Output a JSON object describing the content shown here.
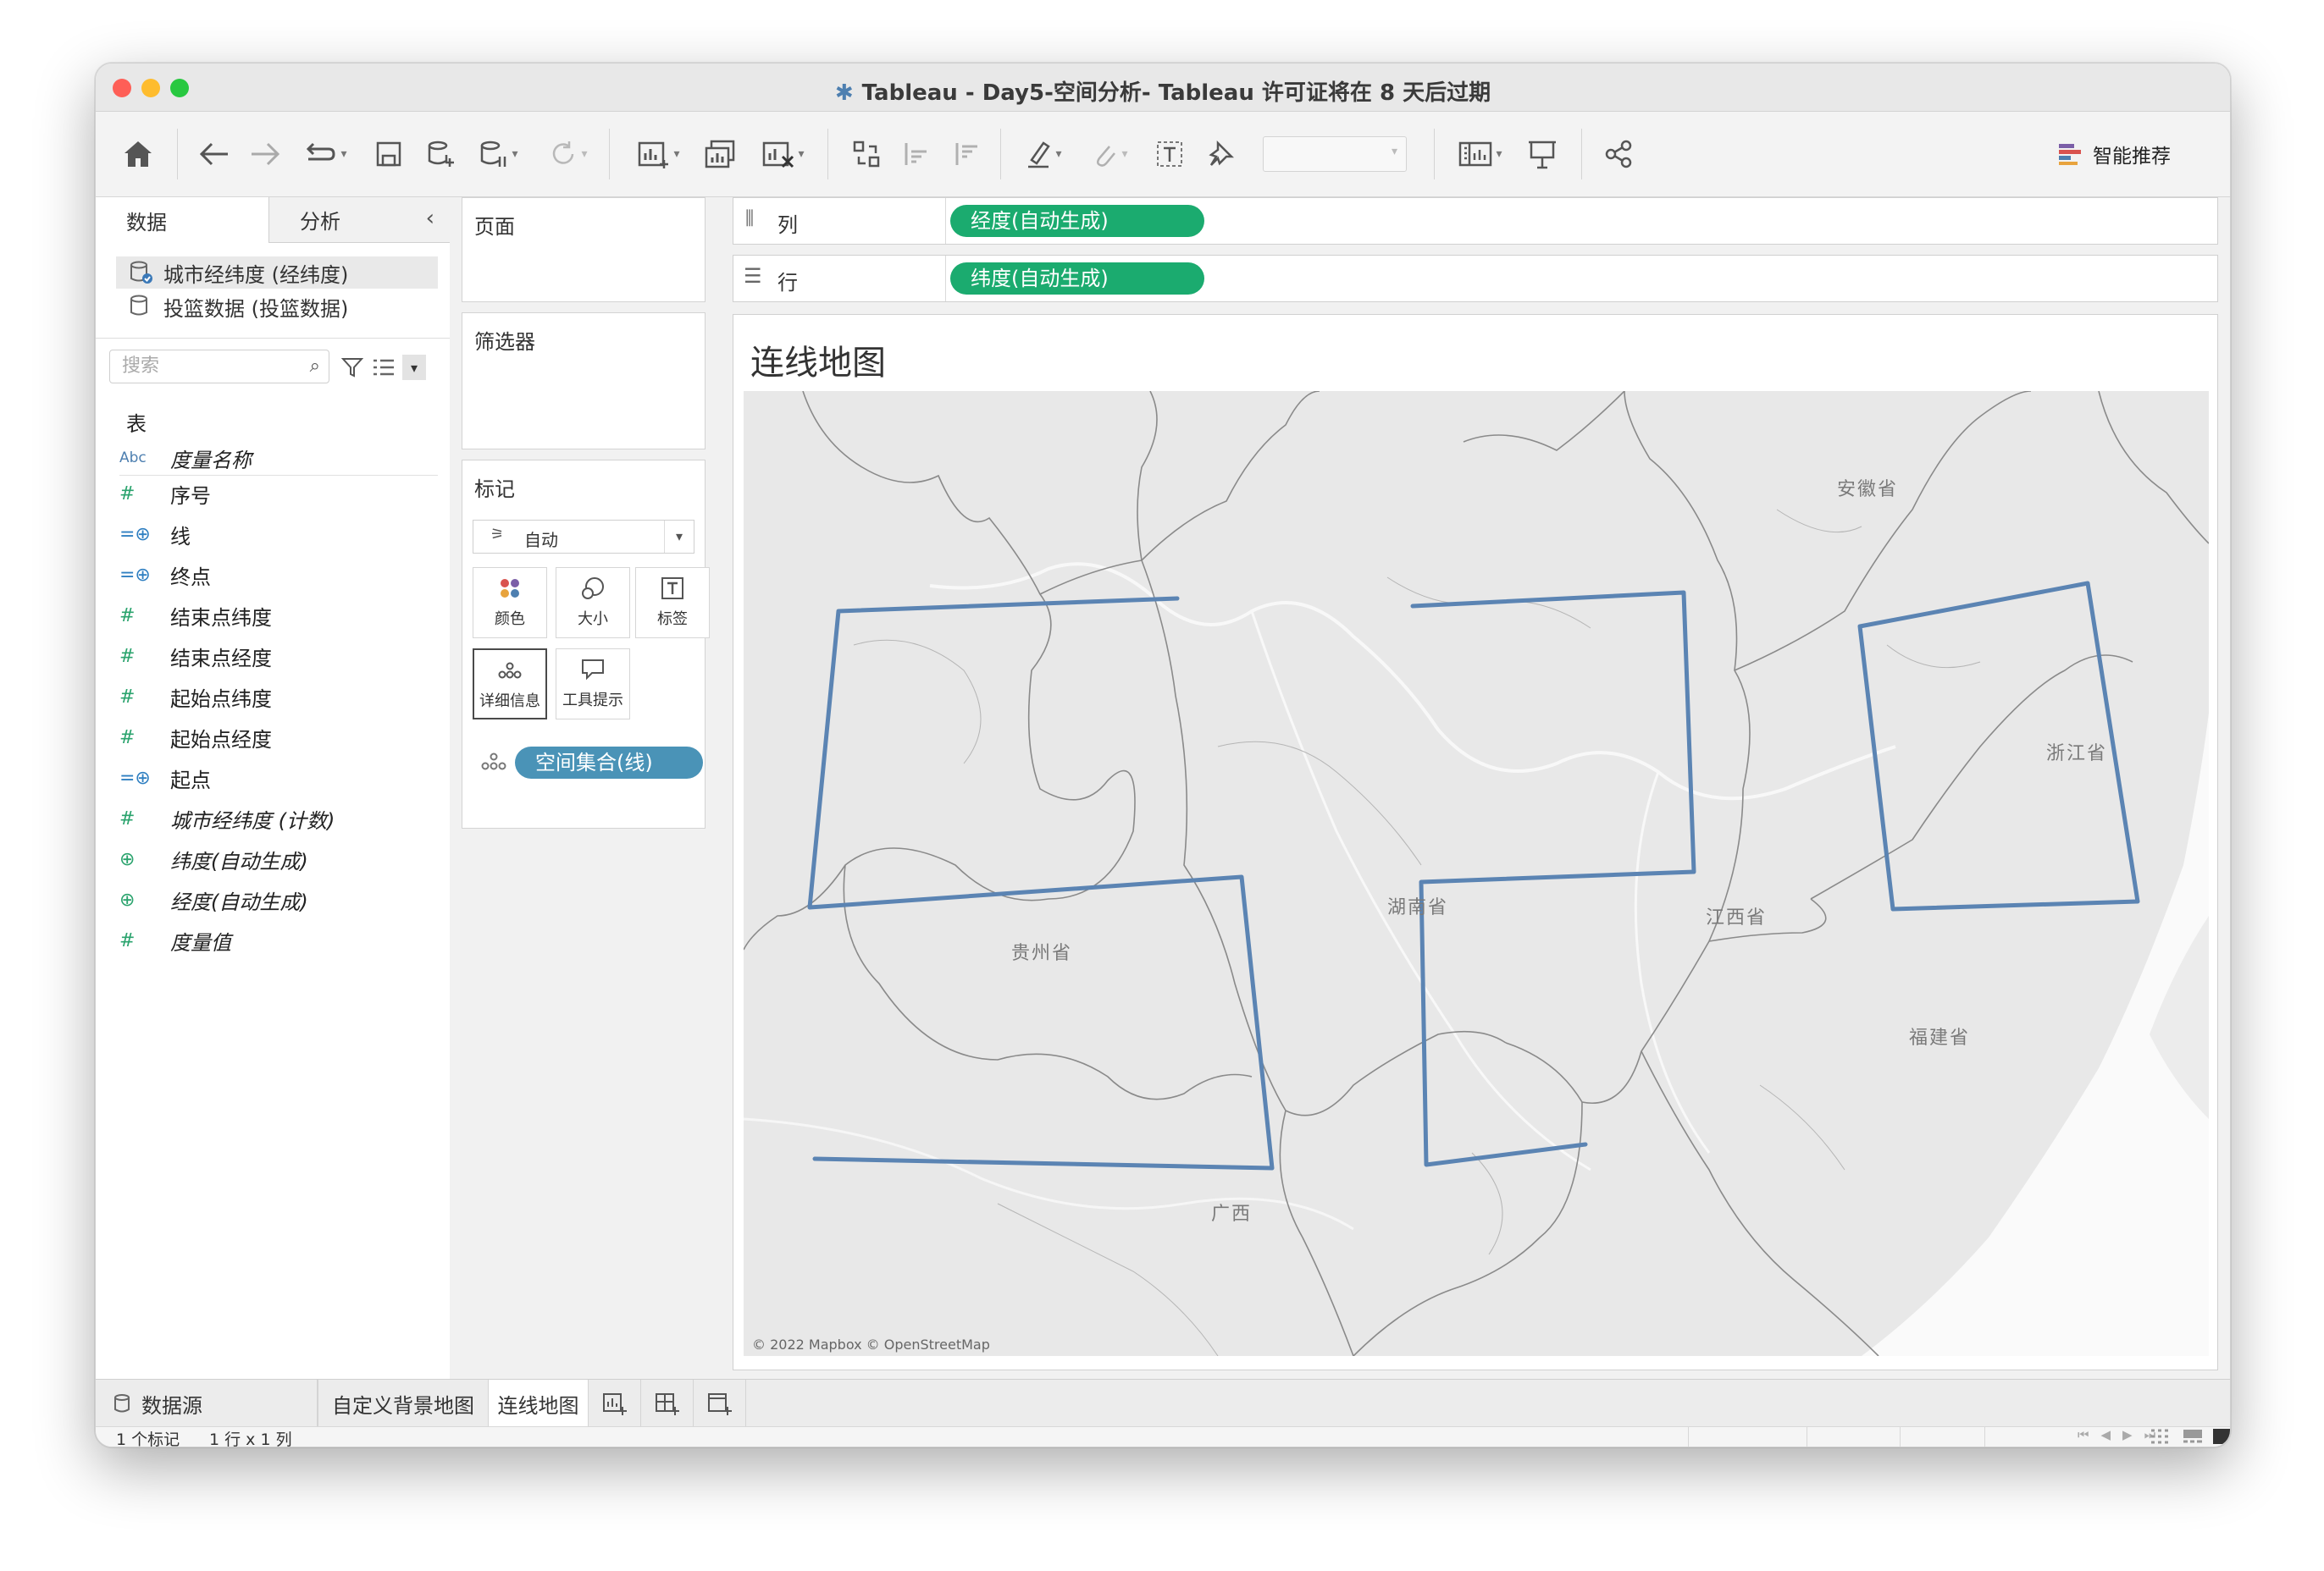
{
  "window": {
    "title": "Tableau - Day5-空间分析- Tableau 许可证将在 8 天后过期"
  },
  "toolbar": {
    "smart_recommend": "智能推荐"
  },
  "left_panel": {
    "tabs": [
      "数据",
      "分析"
    ],
    "datasources": [
      "城市经纬度 (经纬度)",
      "投篮数据 (投篮数据)"
    ],
    "search_placeholder": "搜索",
    "section_label": "表",
    "fields": [
      {
        "type": "Abc",
        "label": "度量名称"
      },
      {
        "type": "#",
        "label": "序号"
      },
      {
        "type": "geo",
        "label": "线"
      },
      {
        "type": "geo",
        "label": "终点"
      },
      {
        "type": "#",
        "label": "结束点纬度"
      },
      {
        "type": "#",
        "label": "结束点经度"
      },
      {
        "type": "#",
        "label": "起始点纬度"
      },
      {
        "type": "#",
        "label": "起始点经度"
      },
      {
        "type": "geo",
        "label": "起点"
      },
      {
        "type": "#",
        "label": "城市经纬度 (计数)"
      },
      {
        "type": "globe",
        "label": "纬度(自动生成)"
      },
      {
        "type": "globe",
        "label": "经度(自动生成)"
      },
      {
        "type": "#",
        "label": "度量值"
      }
    ]
  },
  "middle_panel": {
    "pages_label": "页面",
    "filters_label": "筛选器",
    "marks_label": "标记",
    "mark_type": "自动",
    "mark_buttons": [
      "颜色",
      "大小",
      "标签",
      "详细信息",
      "工具提示"
    ],
    "detail_pill": "空间集合(线)"
  },
  "shelves": {
    "columns_label": "列",
    "columns_pill": "经度(自动生成)",
    "rows_label": "行",
    "rows_pill": "纬度(自动生成)"
  },
  "viz": {
    "title": "连线地图",
    "provinces": [
      "安徽省",
      "浙江省",
      "湖南省",
      "江西省",
      "贵州省",
      "福建省",
      "广西"
    ],
    "attribution": "© 2022 Mapbox © OpenStreetMap"
  },
  "sheet_tabs": {
    "datasource": "数据源",
    "sheets": [
      "自定义背景地图",
      "连线地图"
    ]
  },
  "status": {
    "marks": "1 个标记",
    "layout": "1 行 x 1 列"
  },
  "colors": {
    "pill_green": "#1bab6f",
    "pill_blue": "#4a93b7",
    "line": "#5b84b3"
  }
}
